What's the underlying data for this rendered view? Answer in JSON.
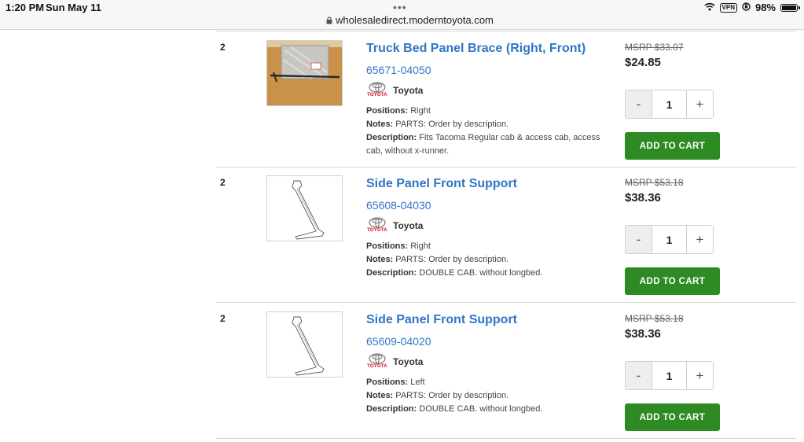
{
  "status_bar": {
    "time": "1:20 PM",
    "date": "Sun May 11",
    "url": "wholesaledirect.moderntoyota.com",
    "vpn": "VPN",
    "battery": "98%",
    "battery_level": 0.98
  },
  "labels": {
    "positions": "Positions:",
    "notes": "Notes:",
    "description": "Description:",
    "add_to_cart": "ADD TO CART",
    "minus": "-",
    "plus": "+"
  },
  "items": [
    {
      "qty_required": "2",
      "title": "Truck Bed Panel Brace (Right, Front)",
      "part_number": "65671-04050",
      "brand": "Toyota",
      "brand_logo_text": "TOYOTA",
      "positions": "Right",
      "notes": "PARTS: Order by description.",
      "description": "Fits Tacoma Regular cab & access cab, access cab, without x-runner.",
      "msrp": "MSRP $33.07",
      "price": "$24.85",
      "quantity": "1",
      "image": "photo-in-bag"
    },
    {
      "qty_required": "2",
      "title": "Side Panel Front Support",
      "part_number": "65608-04030",
      "brand": "Toyota",
      "brand_logo_text": "TOYOTA",
      "positions": "Right",
      "notes": "PARTS: Order by description.",
      "description": "DOUBLE CAB. without longbed.",
      "msrp": "MSRP $53.18",
      "price": "$38.36",
      "quantity": "1",
      "image": "line-drawing"
    },
    {
      "qty_required": "2",
      "title": "Side Panel Front Support",
      "part_number": "65609-04020",
      "brand": "Toyota",
      "brand_logo_text": "TOYOTA",
      "positions": "Left",
      "notes": "PARTS: Order by description.",
      "description": "DOUBLE CAB. without longbed.",
      "msrp": "MSRP $53.18",
      "price": "$38.36",
      "quantity": "1",
      "image": "line-drawing"
    }
  ],
  "colors": {
    "link": "#2f76c6",
    "cart_button": "#2e8a22",
    "toyota_red": "#d6001c"
  }
}
